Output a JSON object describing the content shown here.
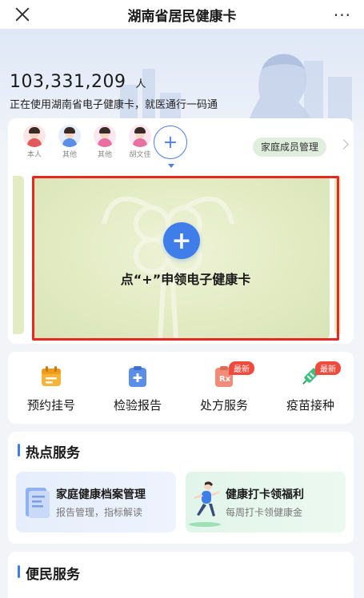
{
  "header": {
    "title": "湖南省居民健康卡",
    "close_icon": "close-icon",
    "more_icon": "more-dots-icon",
    "more_glyph": "···"
  },
  "banner": {
    "count": "103,331,209",
    "unit": "人",
    "description": "正在使用湖南省电子健康卡，就医通行一码通"
  },
  "members": [
    {
      "label": "本人",
      "hair": "#3a2a25",
      "shirt": "#e35a5a"
    },
    {
      "label": "其他",
      "hair": "#3a2a25",
      "shirt": "#5b8ee6"
    },
    {
      "label": "其他",
      "hair": "#3a2a25",
      "shirt": "#e86fa0"
    },
    {
      "label": "胡文佳",
      "hair": "#3a2a25",
      "shirt": "#e86fa0"
    }
  ],
  "add_member_symbol": "+",
  "family_button": "家庭成员管理",
  "health_card": {
    "plus_symbol": "+",
    "apply_text": "点“+”申领电子健康卡"
  },
  "quick_services": [
    {
      "label": "预约挂号",
      "icon": "calendar-icon",
      "badge": ""
    },
    {
      "label": "检验报告",
      "icon": "report-icon",
      "badge": ""
    },
    {
      "label": "处方服务",
      "icon": "prescription-icon",
      "badge": "最新"
    },
    {
      "label": "疫苗接种",
      "icon": "vaccine-icon",
      "badge": "最新"
    }
  ],
  "hot_services": {
    "title": "热点服务",
    "tiles": [
      {
        "title": "家庭健康档案管理",
        "subtitle": "报告管理，指标解读"
      },
      {
        "title": "健康打卡领福利",
        "subtitle": "每周打卡领健康金"
      }
    ]
  },
  "convenience": {
    "title": "便民服务"
  },
  "colors": {
    "accent": "#3f7de8",
    "highlight_frame": "#e8281e",
    "badge": "#ee4b3e",
    "card_green": "#e3ebc3"
  }
}
